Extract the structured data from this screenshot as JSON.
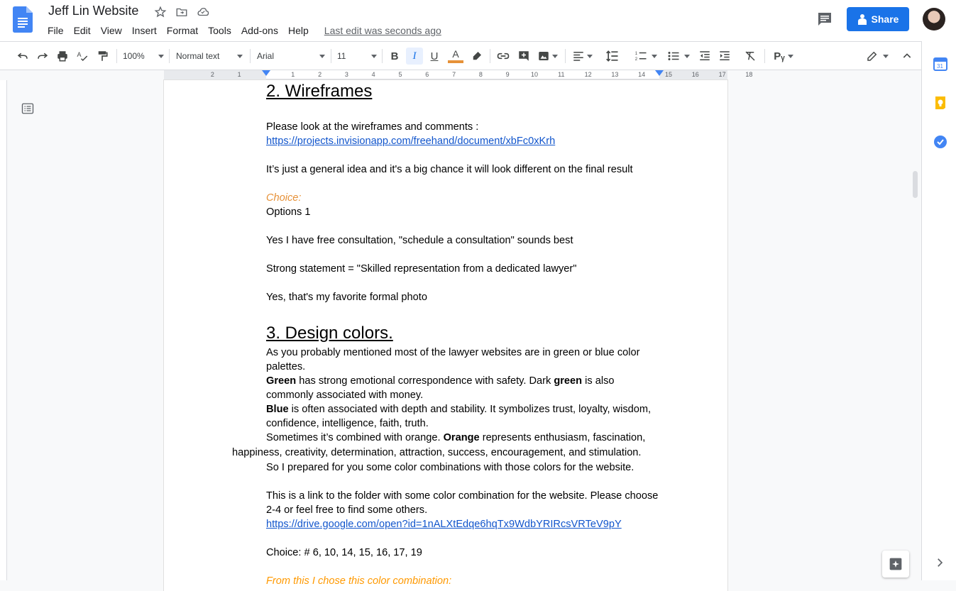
{
  "app": {
    "doc_title": "Jeff Lin Website",
    "menu": [
      "File",
      "Edit",
      "View",
      "Insert",
      "Format",
      "Tools",
      "Add-ons",
      "Help"
    ],
    "last_edit": "Last edit was seconds ago",
    "share_label": "Share"
  },
  "toolbar": {
    "zoom": "100%",
    "style": "Normal text",
    "font": "Arial",
    "size": "11",
    "italic_active": true
  },
  "ruler": {
    "labels": [
      "2",
      "1",
      "1",
      "2",
      "3",
      "4",
      "5",
      "6",
      "7",
      "8",
      "9",
      "10",
      "11",
      "12",
      "13",
      "14",
      "15",
      "16",
      "17",
      "18"
    ]
  },
  "doc": {
    "h_wireframes": "2. Wireframes",
    "p1": "Please look at the wireframes and comments :",
    "link1": "https://projects.invisionapp.com/freehand/document/xbFc0xKrh",
    "p2": "It’s just a general idea and it's a big chance it will look different on the final result",
    "choice_label": "Choice:",
    "options": "Options 1",
    "p3": "Yes I have free consultation, \"schedule a consultation\" sounds best",
    "p4": "Strong statement = \"Skilled representation from a dedicated lawyer\"",
    "p5": "Yes, that's my favorite formal photo",
    "h_colors": "3. Design colors.",
    "p6": "As you probably mentioned most of the lawyer websites are in green or blue color palettes.",
    "green_word": "Green",
    "p7a": " has strong emotional correspondence with safety. Dark ",
    "green_word2": "green",
    "p7b": " is also commonly associated with money.",
    "blue_word": "Blue",
    "p8": " is often associated with depth and stability. It symbolizes trust, loyalty, wisdom, confidence, intelligence, faith, truth.",
    "p9a": "Sometimes it’s combined with orange.  ",
    "orange_word": "Orange",
    "p9b": " represents enthusiasm, fascination, happiness, creativity, determination, attraction, success, encouragement, and stimulation.",
    "p10": "So I prepared for you some color combinations with those colors for the website.",
    "p11": "This is a link to the folder with some color combination for the website. Please choose 2-4 or feel free to find some others.",
    "link2": "https://drive.google.com/open?id=1nALXtEdqe6hqTx9WdbYRIRcsVRTeV9pY",
    "p12": "Choice: # 6, 10, 14, 15, 16, 17, 19",
    "p13": "From this I chose this color combination:"
  },
  "colors": {
    "accent": "#1a73e8",
    "link": "#1155cc",
    "orange": "#e69138"
  }
}
